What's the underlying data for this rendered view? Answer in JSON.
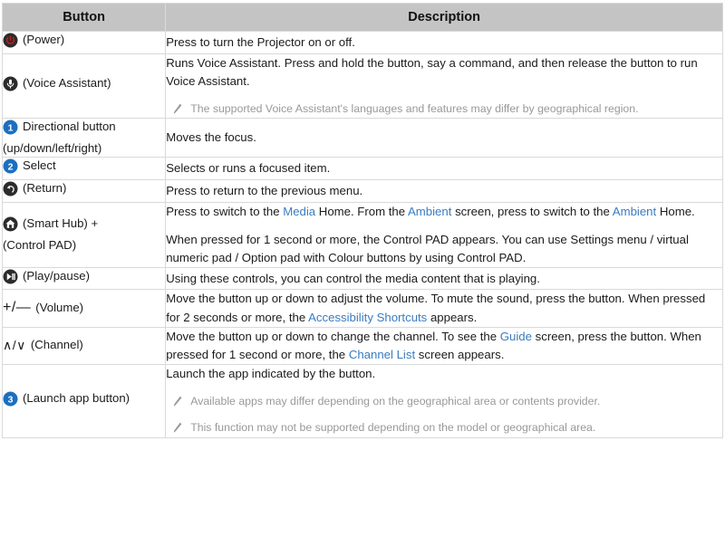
{
  "table": {
    "headers": [
      "Button",
      "Description"
    ],
    "rows": [
      {
        "id": "power",
        "icon": "power-icon",
        "button_label": "(Power)",
        "description": "Press to turn the Projector on or off."
      },
      {
        "id": "voice-assistant",
        "icon": "microphone-icon",
        "button_label": "(Voice Assistant)",
        "description": "Runs Voice Assistant. Press and hold the button, say a command, and then release the button to run Voice Assistant.",
        "notes": [
          "The supported Voice Assistant's languages and features may differ by geographical region."
        ]
      },
      {
        "id": "directional",
        "icon": "number-1-icon",
        "button_label_line1": "Directional button",
        "button_label_line2": "(up/down/left/right)",
        "description": "Moves the focus."
      },
      {
        "id": "select",
        "icon": "number-2-icon",
        "button_label": "Select",
        "description": "Selects or runs a focused item."
      },
      {
        "id": "return",
        "icon": "return-icon",
        "button_label": "(Return)",
        "description": "Press to return to the previous menu."
      },
      {
        "id": "smart-hub",
        "icon": "home-icon",
        "button_label_line1": "(Smart Hub) +",
        "button_label_line2": "(Control PAD)",
        "paragraphs": [
          {
            "segments": [
              {
                "text": "Press to switch to the ",
                "link": false
              },
              {
                "text": "Media",
                "link": true
              },
              {
                "text": " Home. From the ",
                "link": false
              },
              {
                "text": "Ambient",
                "link": true
              },
              {
                "text": " screen, press to switch to the ",
                "link": false
              },
              {
                "text": "Ambient",
                "link": true
              },
              {
                "text": " Home.",
                "link": false
              }
            ]
          },
          {
            "segments": [
              {
                "text": "When pressed for 1 second or more, the Control PAD appears. You can use Settings menu / virtual numeric pad / Option pad with Colour buttons by using Control PAD.",
                "link": false
              }
            ]
          }
        ]
      },
      {
        "id": "play-pause",
        "icon": "play-pause-icon",
        "button_label": "(Play/pause)",
        "description": "Using these controls, you can control the media content that is playing."
      },
      {
        "id": "volume",
        "glyph": "+/—",
        "button_label": "(Volume)",
        "paragraphs": [
          {
            "segments": [
              {
                "text": "Move the button up or down to adjust the volume. To mute the sound, press the button. When pressed for 2 seconds or more, the ",
                "link": false
              },
              {
                "text": "Accessibility Shortcuts",
                "link": true
              },
              {
                "text": " appears.",
                "link": false
              }
            ]
          }
        ]
      },
      {
        "id": "channel",
        "glyph": "∧/∨",
        "button_label": "(Channel)",
        "paragraphs": [
          {
            "segments": [
              {
                "text": "Move the button up or down to change the channel. To see the ",
                "link": false
              },
              {
                "text": "Guide",
                "link": true
              },
              {
                "text": " screen, press the button. When pressed for 1 second or more, the ",
                "link": false
              },
              {
                "text": "Channel List",
                "link": true
              },
              {
                "text": " screen appears.",
                "link": false
              }
            ]
          }
        ]
      },
      {
        "id": "launch-app",
        "icon": "number-3-icon",
        "button_label": "(Launch app button)",
        "description": "Launch the app indicated by the button.",
        "notes": [
          "Available apps may differ depending on the geographical area or contents provider.",
          "This function may not be supported depending on the model or geographical area."
        ]
      }
    ]
  },
  "colors": {
    "header_bg": "#c4c4c4",
    "link": "#3a7cc0",
    "note_text": "#999999",
    "badge_blue": "#1b6fc0",
    "icon_dark": "#2b2b2b",
    "power_red": "#c0201f",
    "border": "#d9d9d9"
  }
}
